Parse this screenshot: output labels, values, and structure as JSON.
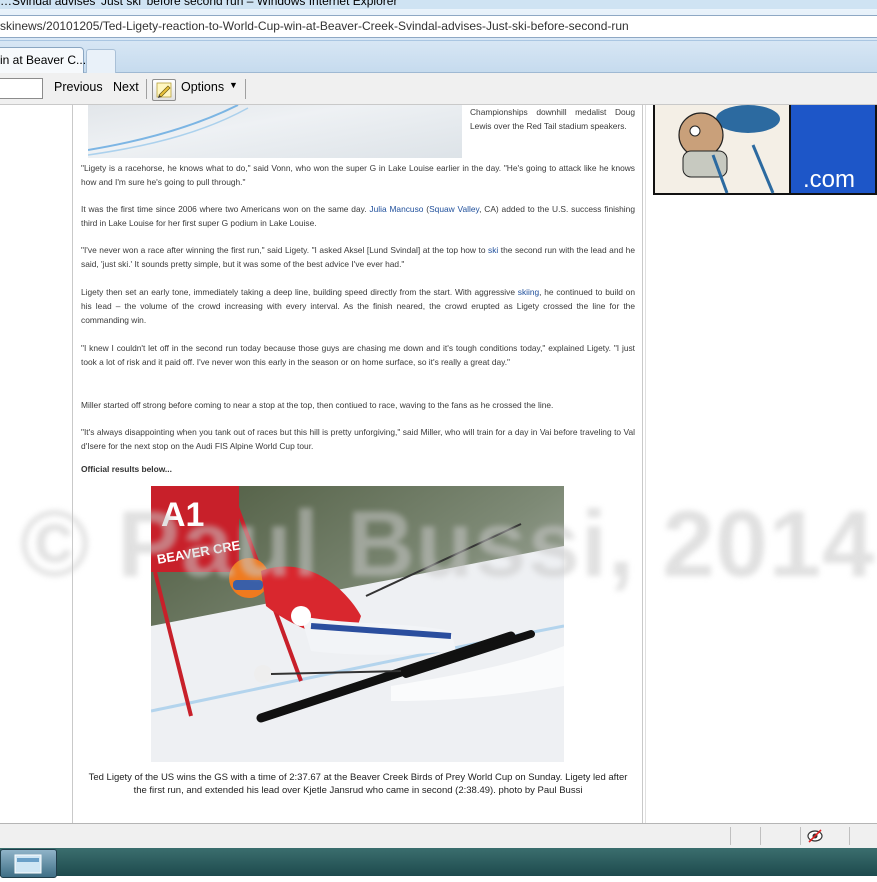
{
  "window": {
    "title": "…Svindal advises 'Just ski' before second run – Windows Internet Explorer",
    "address": "skinews/20101205/Ted-Ligety-reaction-to-World-Cup-win-at-Beaver-Creek-Svindal-advises-Just-ski-before-second-run",
    "tab_label": "in at Beaver C..."
  },
  "findbar": {
    "previous_label": "Previous",
    "next_label": "Next",
    "options_label": "Options"
  },
  "article": {
    "side_caption": "Championships downhill medalist Doug Lewis over the Red Tail stadium speakers.",
    "p1": "\"Ligety is a racehorse, he knows what to do,\" said Vonn, who won the super G in Lake Louise earlier in the day. \"He's going to attack like he knows how and I'm sure he's going to pull through.\"",
    "p2_a": "It was the first time since 2006 where two Americans won on the same day. ",
    "p2_link1": "Julia Mancuso",
    "p2_b": " (",
    "p2_link2": "Squaw Valley",
    "p2_c": ", CA) added to the U.S. success finishing third in Lake Louise for her first super G podium in Lake Louise.",
    "p3_a": "\"I've never won a race after winning the first run,\" said Ligety. \"I asked Aksel [Lund Svindal] at the top how to ",
    "p3_link": "ski",
    "p3_b": " the second run with the lead and he said, 'just ski.' It sounds pretty simple, but it was some of the best advice I've ever had.\"",
    "p4_a": "Ligety then set an early tone, immediately taking a deep line, building speed directly from the start. With aggressive ",
    "p4_link": "skiing",
    "p4_b": ", he continued to build on his lead – the volume of the crowd increasing with every interval. As the finish neared, the crowd erupted as Ligety crossed the line for the commanding win.",
    "p5": "\"I knew I couldn't let off in the second run today because those guys are chasing me down and it's tough conditions today,\" explained Ligety. \"I just took a lot of risk and it paid off. I've never won this early in the season or on home surface, so it's really a great day.\"",
    "p6": "Miller started off strong before coming to near a stop at the top, then contiued to race, waving to the fans as he crossed the line.",
    "p7": "\"It's always disappointing when you tank out of races but this hill is pretty unforgiving,\" said Miller, who will train for a day in Vai before traveling to Val d'Isere for the next stop on the Audi FIS Alpine World Cup tour.",
    "results_heading": "Official results below...",
    "photo_caption": "Ted Ligety of the US wins the GS with a time of 2:37.67 at the Beaver Creek Birds of Prey World Cup on Sunday. Ligety led after the first run, and extended his lead over Kjetle Jansrud who came in second (2:38.49). photo by Paul Bussi",
    "gate_banner_top": "A1",
    "gate_banner_bottom": "BEAVER CRE"
  },
  "ad": {
    "text": ".com"
  },
  "watermark": "© Paul Bussi, 2014",
  "icons": {
    "pencil": "pencil-icon",
    "dropdown": "chevron-down-icon",
    "protected_mode": "eye-icon"
  },
  "colors": {
    "link": "#1f4f9b",
    "chrome": "#d9e8f6",
    "taskbar": "#1d4a4d"
  }
}
